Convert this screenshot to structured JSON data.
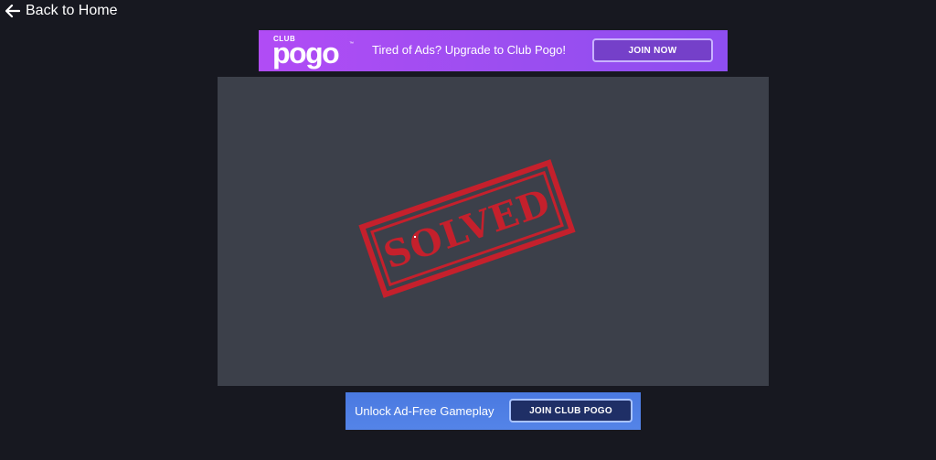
{
  "nav": {
    "back_label": "Back to Home",
    "back_icon": "arrow-left-icon"
  },
  "top_banner": {
    "logo_small": "CLUB",
    "logo_main": "pogo",
    "logo_tm": "™",
    "text": "Tired of Ads? Upgrade to Club Pogo!",
    "button_label": "JOIN NOW"
  },
  "game": {
    "stamp_text": "SOLVED"
  },
  "bottom_banner": {
    "text": "Unlock Ad-Free Gameplay",
    "button_label": "JOIN CLUB POGO"
  },
  "colors": {
    "page_background": "#171820",
    "game_background": "#3c404a",
    "stamp": "#c5202c",
    "top_banner": "#a94ff3",
    "bottom_banner": "#5080e6"
  }
}
